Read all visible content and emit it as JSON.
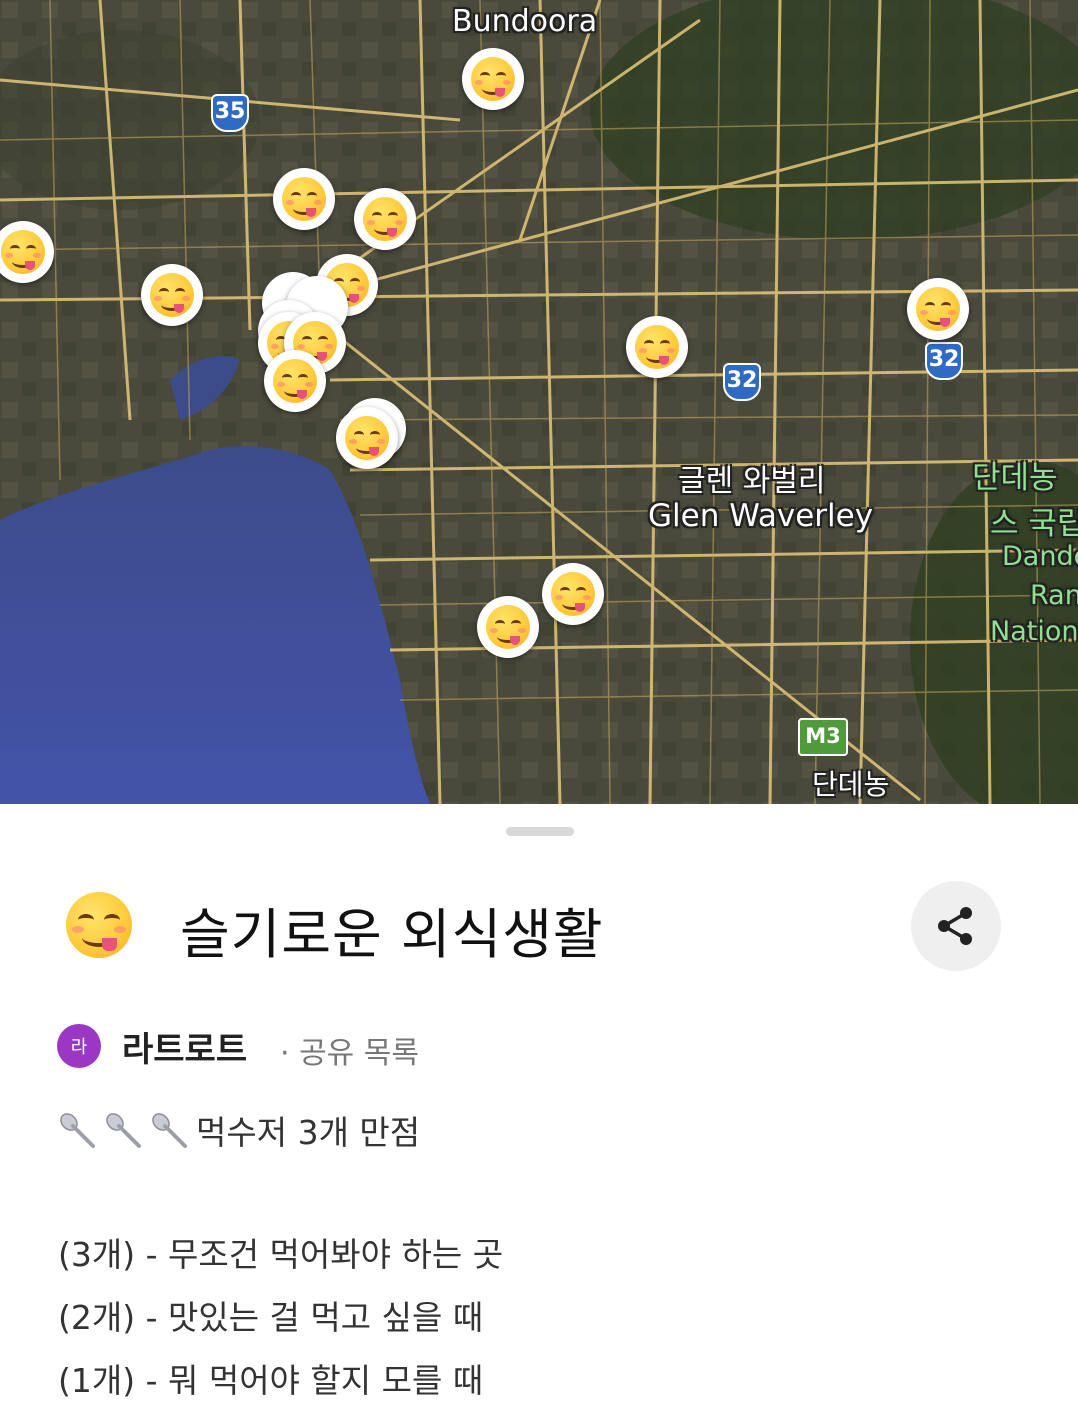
{
  "map": {
    "place_labels": {
      "bundoora": "Bundoora",
      "glen_waverley_ko": "글렌 와벌리",
      "glen_waverley_en": "Glen Waverley",
      "dandenong_ko": "단데농",
      "dandenong_park_ko_1": "단데농",
      "dandenong_park_ko_2": "스 국립",
      "dandenong_park_en_1": "Dande",
      "dandenong_park_en_2": "Ran",
      "dandenong_park_en_3": "Nation"
    },
    "route_shields": {
      "r35": "35",
      "r32_a": "32",
      "r32_b": "32",
      "m3": "M3"
    },
    "marker_icon": "face-savoring-food-emoji"
  },
  "sheet": {
    "title": "슬기로운 외식생활",
    "title_icon": "face-savoring-food-emoji",
    "share_icon": "share-icon",
    "author": {
      "avatar_letter": "라",
      "avatar_color": "#9b37c4",
      "name": "라트로트",
      "meta": "· 공유 목록"
    },
    "description": {
      "rating_line": "먹수저 3개 만점",
      "rating_icon": "spoon-icon",
      "rating_icon_count": 3,
      "levels": [
        "(3개) - 무조건 먹어봐야 하는 곳",
        "(2개) - 맛있는 걸 먹고 싶을 때",
        "(1개) - 뭐 먹어야 할지 모를 때"
      ]
    }
  },
  "colors": {
    "water": "#3b4f9c",
    "road": "#e7c878",
    "shield_blue": "#2f6bc4",
    "shield_green": "#4f9a3a"
  }
}
